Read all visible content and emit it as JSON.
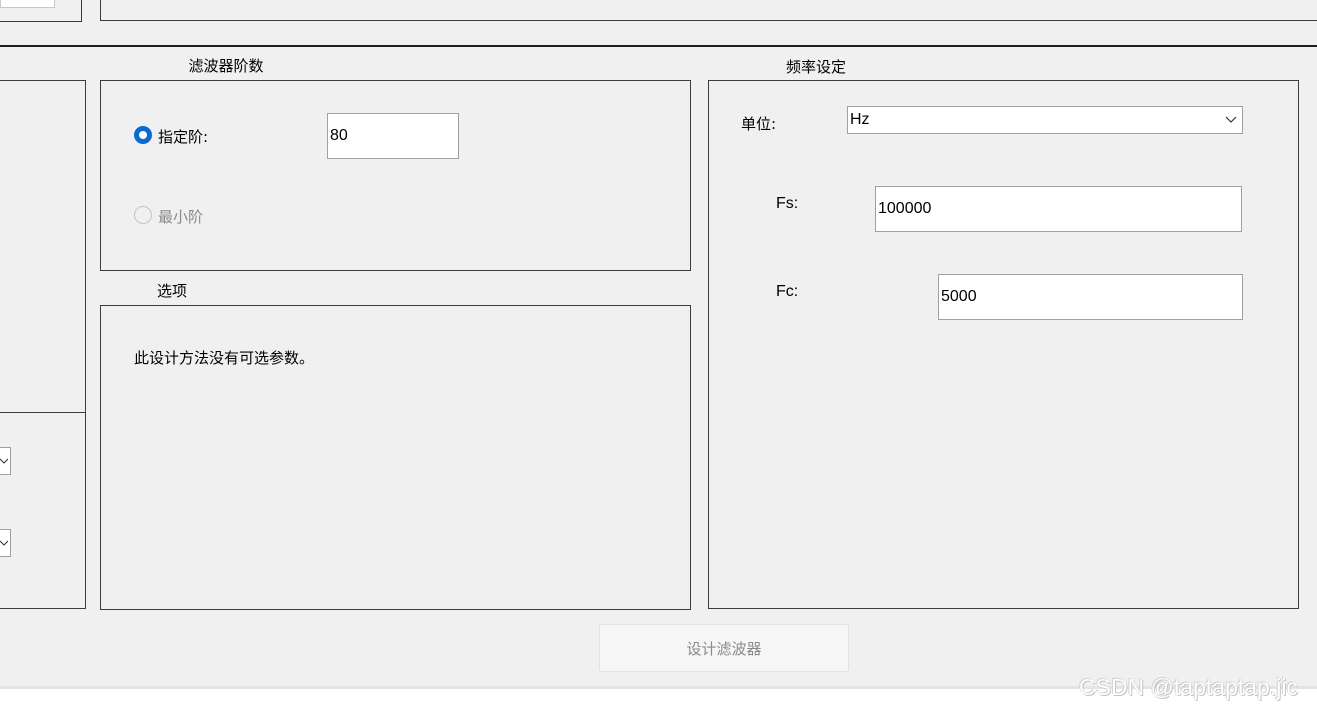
{
  "order_group": {
    "legend": "滤波器阶数",
    "specify_order": {
      "label": "指定阶:",
      "selected": true,
      "value": "80"
    },
    "minimum_order": {
      "label": "最小阶",
      "selected": false,
      "enabled": false
    }
  },
  "options_group": {
    "legend": "选项",
    "message": "此设计方法没有可选参数。"
  },
  "frequency_group": {
    "legend": "频率设定",
    "units": {
      "label": "单位:",
      "value": "Hz"
    },
    "fs": {
      "label": "Fs:",
      "value": "100000"
    },
    "fc": {
      "label": "Fc:",
      "value": "5000"
    }
  },
  "design_button": {
    "label": "设计滤波器",
    "enabled": false
  },
  "watermark": "CSDN @taptaptap.jic",
  "colors": {
    "radio_selected": "#0a6ad1",
    "background": "#f0f0f0",
    "disabled_text": "#8a8a8a"
  }
}
